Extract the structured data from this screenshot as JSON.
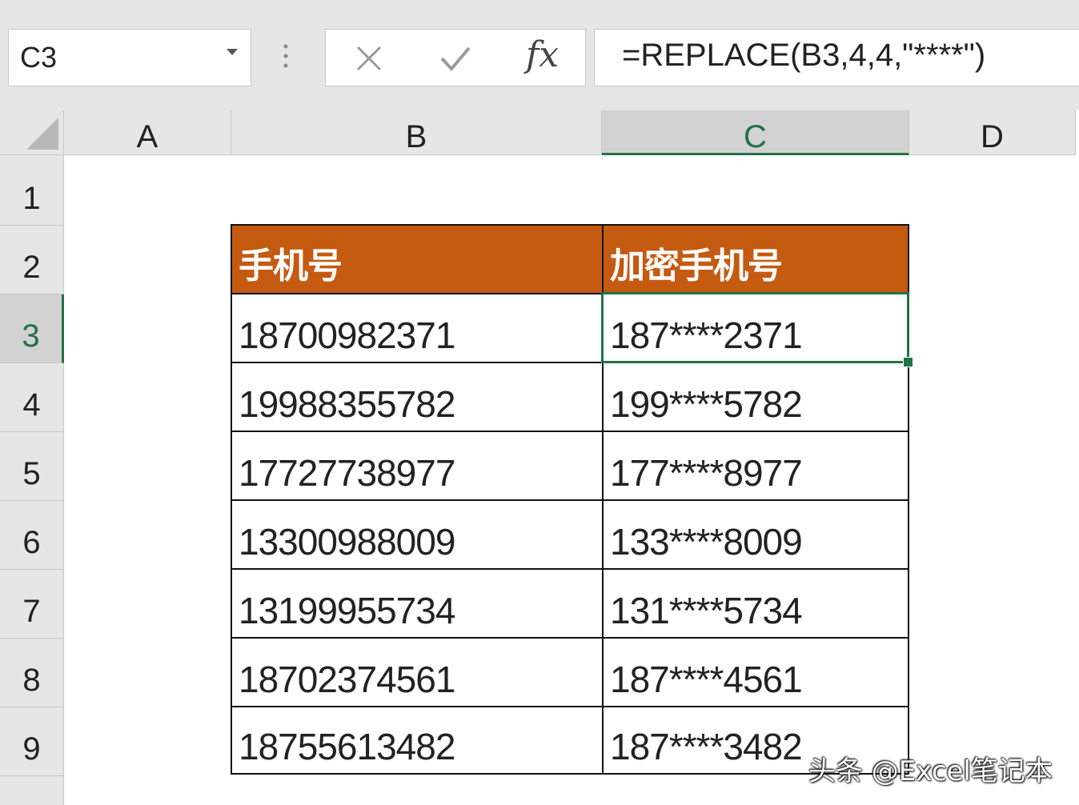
{
  "formula_bar": {
    "name_box": "C3",
    "formula": "=REPLACE(B3,4,4,\"****\")",
    "fx_label": "fx"
  },
  "columns": [
    "A",
    "B",
    "C",
    "D"
  ],
  "selected_column": "C",
  "rows": [
    "1",
    "2",
    "3",
    "4",
    "5",
    "6",
    "7",
    "8",
    "9"
  ],
  "selected_row": "3",
  "table": {
    "headers": [
      "手机号",
      "加密手机号"
    ],
    "header_color": "#c55a11",
    "rows": [
      [
        "18700982371",
        "187****2371"
      ],
      [
        "19988355782",
        "199****5782"
      ],
      [
        "17727738977",
        "177****8977"
      ],
      [
        "13300988009",
        "133****8009"
      ],
      [
        "13199955734",
        "131****5734"
      ],
      [
        "18702374561",
        "187****4561"
      ],
      [
        "18755613482",
        "187****3482"
      ]
    ]
  },
  "accent_color": "#217346",
  "watermark": "头条 @Excel笔记本"
}
